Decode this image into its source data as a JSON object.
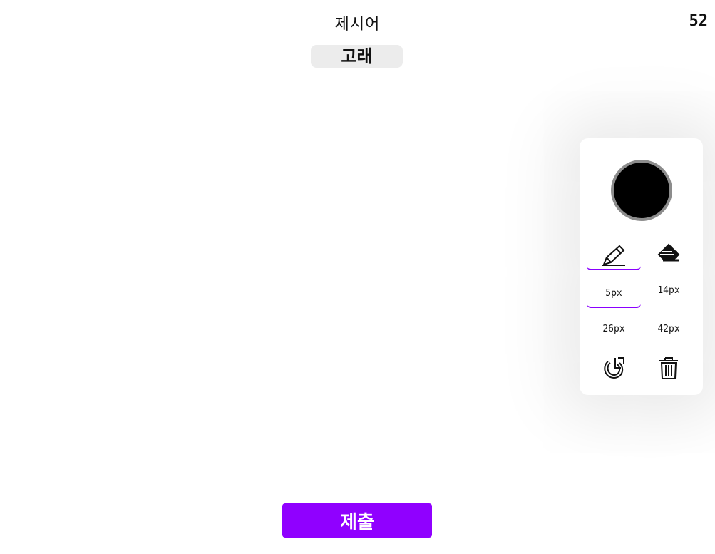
{
  "header": {
    "prompt_label": "제시어",
    "timer": "52",
    "word": "고래"
  },
  "toolbox": {
    "current_color": "#000000",
    "swatch_border_color": "#8c8c8c",
    "accent_color": "#8a00ff",
    "tools": {
      "pencil_icon": "pencil-icon",
      "eraser_icon": "eraser-icon",
      "undo_icon": "undo-icon",
      "trash_icon": "trash-icon"
    },
    "sizes": [
      "5px",
      "14px",
      "26px",
      "42px"
    ],
    "selected_tool": "pencil",
    "selected_size": "5px"
  },
  "footer": {
    "submit_label": "제출",
    "submit_color": "#9000ff"
  }
}
